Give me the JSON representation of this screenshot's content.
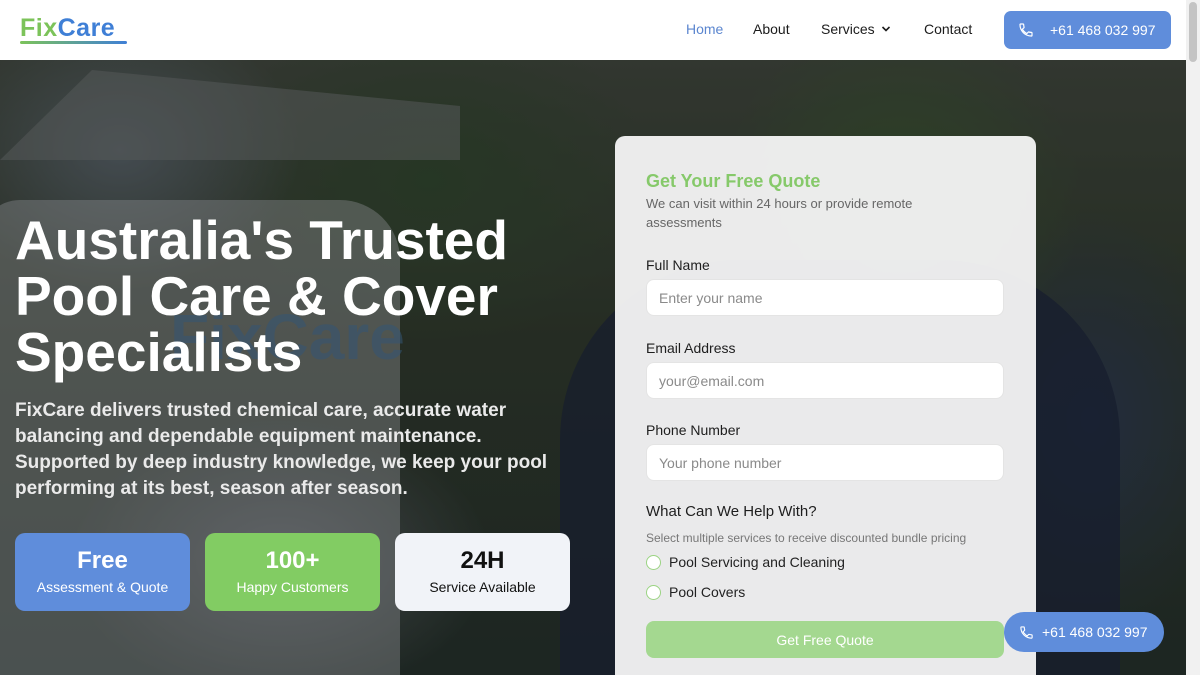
{
  "brand": {
    "logo_part1": "Fix",
    "logo_part2": "Care"
  },
  "nav": {
    "home": "Home",
    "about": "About",
    "services": "Services",
    "contact": "Contact"
  },
  "header_phone": "+61 468 032 997",
  "hero": {
    "headline": "Australia's Trusted Pool Care & Cover Specialists",
    "subtext": "FixCare delivers trusted chemical care, accurate water balancing and dependable equipment maintenance. Supported by deep industry knowledge, we keep your pool performing at its best, season after season.",
    "van_text": "FixCare"
  },
  "stats": [
    {
      "big": "Free",
      "small": "Assessment & Quote"
    },
    {
      "big": "100+",
      "small": "Happy Customers"
    },
    {
      "big": "24H",
      "small": "Service Available"
    }
  ],
  "quote_form": {
    "title": "Get Your Free Quote",
    "subtitle": "We can visit within 24 hours or provide remote assessments",
    "name_label": "Full Name",
    "name_placeholder": "Enter your name",
    "email_label": "Email Address",
    "email_placeholder": "your@email.com",
    "phone_label": "Phone Number",
    "phone_placeholder": "Your phone number",
    "help_title": "What Can We Help With?",
    "help_subtitle": "Select multiple services to receive discounted bundle pricing",
    "options": [
      "Pool Servicing and Cleaning",
      "Pool Covers"
    ],
    "submit_label": "Get Free Quote"
  },
  "floating_phone": "+61 468 032 997",
  "colors": {
    "brand_blue": "#5f8ddb",
    "brand_green": "#82cc63"
  }
}
